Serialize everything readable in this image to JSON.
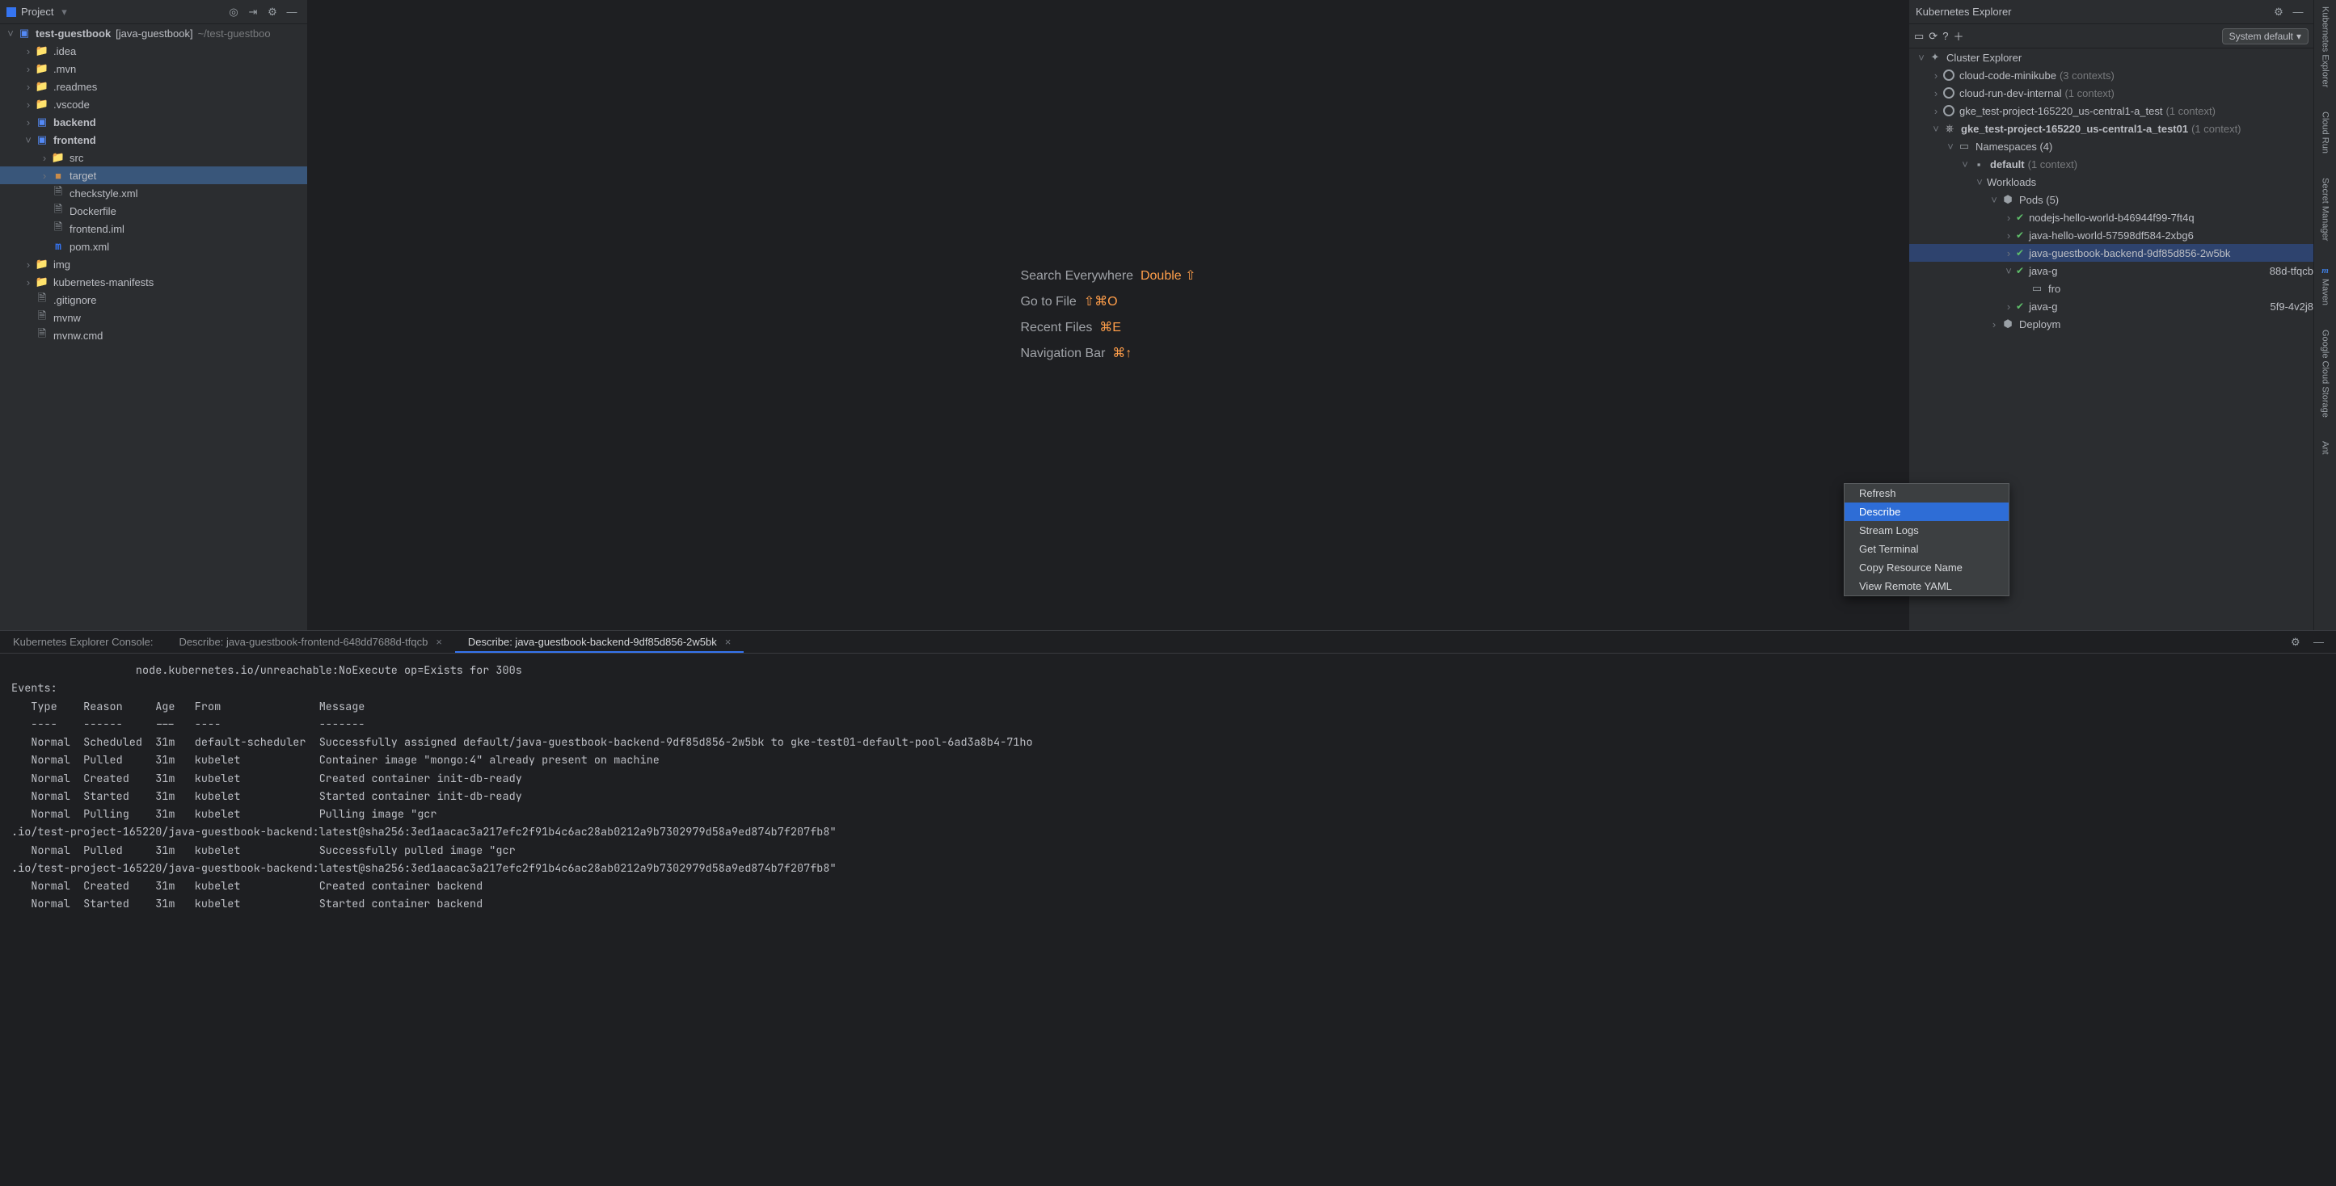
{
  "chart_data": null,
  "project_panel": {
    "title": "Project",
    "root": {
      "name": "test-guestbook",
      "hint": "[java-guestbook]",
      "path": "~/test-guestboo"
    },
    "items": [
      {
        "label": ".idea",
        "indent": 1,
        "chev": "›",
        "icon": "dir"
      },
      {
        "label": ".mvn",
        "indent": 1,
        "chev": "›",
        "icon": "dir"
      },
      {
        "label": ".readmes",
        "indent": 1,
        "chev": "›",
        "icon": "dir"
      },
      {
        "label": ".vscode",
        "indent": 1,
        "chev": "›",
        "icon": "dir"
      },
      {
        "label": "backend",
        "indent": 1,
        "chev": "›",
        "icon": "bluedir",
        "bold": true
      },
      {
        "label": "frontend",
        "indent": 1,
        "chev": "v",
        "icon": "bluedir",
        "bold": true
      },
      {
        "label": "src",
        "indent": 2,
        "chev": "›",
        "icon": "dir"
      },
      {
        "label": "target",
        "indent": 2,
        "chev": "›",
        "icon": "orangedir",
        "selected": true
      },
      {
        "label": "checkstyle.xml",
        "indent": 2,
        "chev": "",
        "icon": "xml"
      },
      {
        "label": "Dockerfile",
        "indent": 2,
        "chev": "",
        "icon": "file"
      },
      {
        "label": "frontend.iml",
        "indent": 2,
        "chev": "",
        "icon": "iml"
      },
      {
        "label": "pom.xml",
        "indent": 2,
        "chev": "",
        "icon": "m"
      },
      {
        "label": "img",
        "indent": 1,
        "chev": "›",
        "icon": "dir"
      },
      {
        "label": "kubernetes-manifests",
        "indent": 1,
        "chev": "›",
        "icon": "dir"
      },
      {
        "label": ".gitignore",
        "indent": 1,
        "chev": "",
        "icon": "file"
      },
      {
        "label": "mvnw",
        "indent": 1,
        "chev": "",
        "icon": "file"
      },
      {
        "label": "mvnw.cmd",
        "indent": 1,
        "chev": "",
        "icon": "file"
      }
    ]
  },
  "editor": {
    "l1a": "Search Everywhere",
    "l1b": "Double ⇧",
    "l2a": "Go to File",
    "l2b": "⇧⌘O",
    "l3a": "Recent Files",
    "l3b": "⌘E",
    "l4a": "Navigation Bar",
    "l4b": "⌘↑"
  },
  "kube": {
    "title": "Kubernetes Explorer",
    "system_default": "System default",
    "root": "Cluster Explorer",
    "clusters": [
      {
        "name": "cloud-code-minikube",
        "ctx": "(3 contexts)"
      },
      {
        "name": "cloud-run-dev-internal",
        "ctx": "(1 context)"
      },
      {
        "name": "gke_test-project-165220_us-central1-a_test",
        "ctx": "(1 context)"
      }
    ],
    "active_cluster": {
      "name": "gke_test-project-165220_us-central1-a_test01",
      "ctx": "(1 context)"
    },
    "namespaces_label": "Namespaces (4)",
    "default_ns": {
      "label": "default",
      "ctx": "(1 context)"
    },
    "workloads": "Workloads",
    "pods_label": "Pods (5)",
    "pods": [
      "nodejs-hello-world-b46944f99-7ft4q",
      "java-hello-world-57598df584-2xbg6",
      "java-guestbook-backend-9df85d856-2w5bk",
      "java-g",
      "fro",
      "java-g"
    ],
    "pod3_suffix": "88d-tfqcb",
    "pod5_suffix": "5f9-4v2j8",
    "deployments": "Deploym",
    "context_menu": [
      "Refresh",
      "Describe",
      "Stream Logs",
      "Get Terminal",
      "Copy Resource Name",
      "View Remote YAML"
    ]
  },
  "rail": [
    "Kubernetes Explorer",
    "Cloud Run",
    "Secret Manager",
    "Maven",
    "Google Cloud Storage",
    "Ant"
  ],
  "console": {
    "tab0": "Kubernetes Explorer Console:",
    "tab1": "Describe: java-guestbook-frontend-648dd7688d-tfqcb",
    "tab2": "Describe: java-guestbook-backend-9df85d856-2w5bk",
    "body": "                   node.kubernetes.io/unreachable:NoExecute op=Exists for 300s\nEvents:\n   Type    Reason     Age   From               Message\n   ----    ------     ---   ----               -------\n   Normal  Scheduled  31m   default-scheduler  Successfully assigned default/java-guestbook-backend-9df85d856-2w5bk to gke-test01-default-pool-6ad3a8b4-71ho\n   Normal  Pulled     31m   kubelet            Container image \"mongo:4\" already present on machine\n   Normal  Created    31m   kubelet            Created container init-db-ready\n   Normal  Started    31m   kubelet            Started container init-db-ready\n   Normal  Pulling    31m   kubelet            Pulling image \"gcr\n.io/test-project-165220/java-guestbook-backend:latest@sha256:3ed1aacac3a217efc2f91b4c6ac28ab0212a9b7302979d58a9ed874b7f207fb8\"\n   Normal  Pulled     31m   kubelet            Successfully pulled image \"gcr\n.io/test-project-165220/java-guestbook-backend:latest@sha256:3ed1aacac3a217efc2f91b4c6ac28ab0212a9b7302979d58a9ed874b7f207fb8\"\n   Normal  Created    31m   kubelet            Created container backend\n   Normal  Started    31m   kubelet            Started container backend"
  }
}
